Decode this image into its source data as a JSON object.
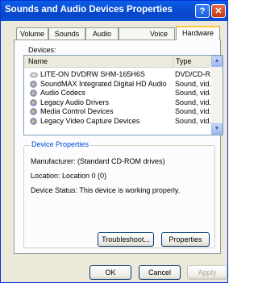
{
  "window": {
    "title": "Sounds and Audio Devices Properties",
    "help_glyph": "?",
    "close_glyph": "✕"
  },
  "tabs": [
    "Volume",
    "Sounds",
    "Audio",
    "Voice",
    "Hardware"
  ],
  "active_tab": "Hardware",
  "devices": {
    "label": "Devices:",
    "columns": {
      "name": "Name",
      "type": "Type"
    },
    "rows": [
      {
        "name": "LITE-ON DVDRW SHM-165H6S",
        "type": "DVD/CD-R...",
        "icon": "cd-drive-icon"
      },
      {
        "name": "SoundMAX Integrated Digital HD Audio",
        "type": "Sound, vid...",
        "icon": "sound-device-icon"
      },
      {
        "name": "Audio Codecs",
        "type": "Sound, vid...",
        "icon": "sound-device-icon"
      },
      {
        "name": "Legacy Audio Drivers",
        "type": "Sound, vid...",
        "icon": "sound-device-icon"
      },
      {
        "name": "Media Control Devices",
        "type": "Sound, vid...",
        "icon": "sound-device-icon"
      },
      {
        "name": "Legacy Video Capture Devices",
        "type": "Sound, vid...",
        "icon": "sound-device-icon"
      }
    ]
  },
  "device_properties": {
    "title": "Device Properties",
    "manufacturer": "Manufacturer: (Standard CD-ROM drives)",
    "location": "Location: Location 0 (0)",
    "status": "Device Status: This device is working properly."
  },
  "buttons": {
    "troubleshoot": "Troubleshoot...",
    "properties": "Properties",
    "ok": "OK",
    "cancel": "Cancel",
    "apply": "Apply"
  },
  "colors": {
    "titlebar": "#0a4fd6",
    "accent_text": "#0046d5",
    "selected_tab_highlight": "#ffc83c"
  }
}
